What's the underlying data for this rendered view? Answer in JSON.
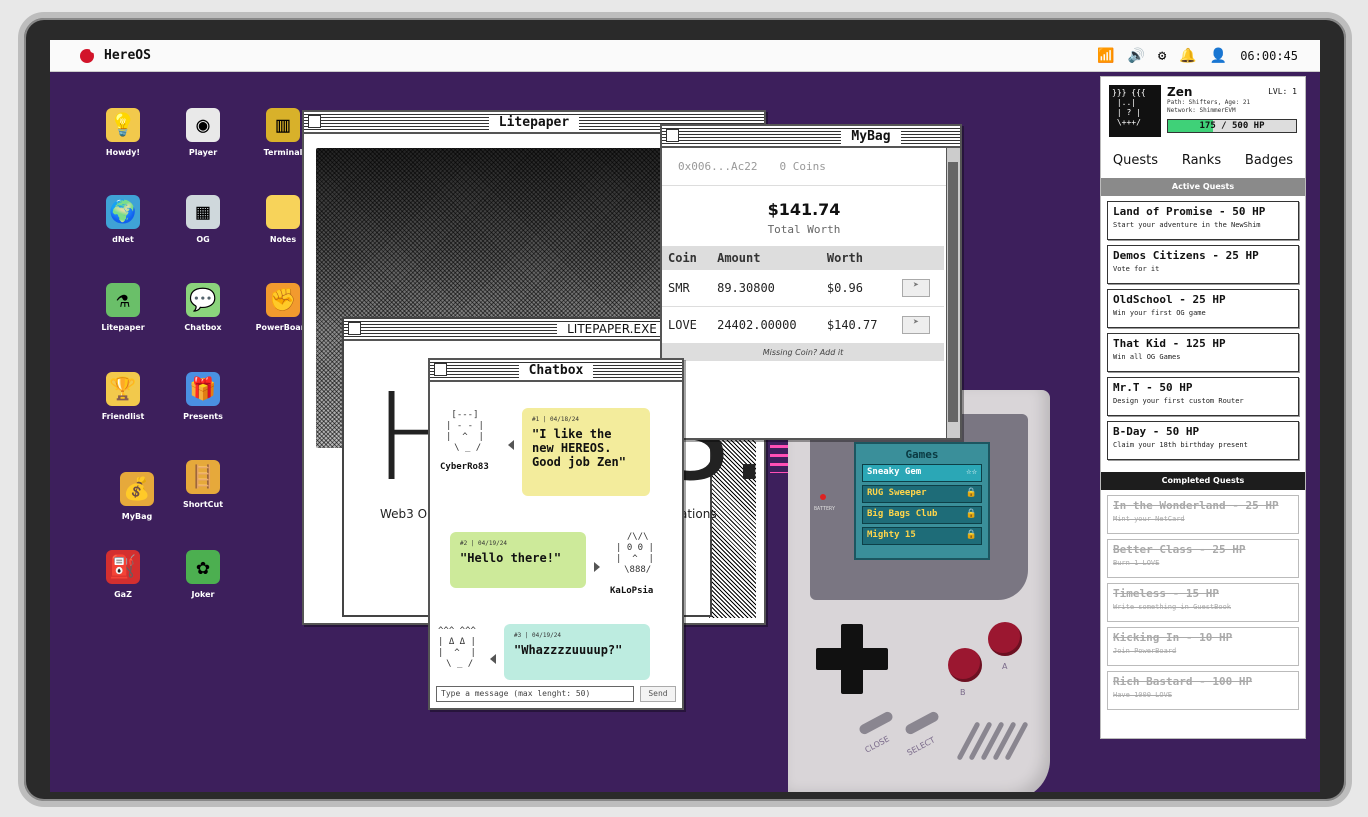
{
  "menubar": {
    "os_name": "HereOS",
    "clock": "06:00:45"
  },
  "desktop_icons": [
    {
      "label": "Howdy!",
      "glyph": "💡",
      "bg": "#f2c94c"
    },
    {
      "label": "Player",
      "glyph": "◉",
      "bg": "#e9e9e9"
    },
    {
      "label": "Terminal",
      "glyph": "▥",
      "bg": "#d8b12a"
    },
    {
      "label": "dNet",
      "glyph": "🌍",
      "bg": "#3fa2d6"
    },
    {
      "label": "OG",
      "glyph": "▦",
      "bg": "#cfd8dc"
    },
    {
      "label": "Notes",
      "glyph": "",
      "bg": "#f7d35a"
    },
    {
      "label": "Litepaper",
      "glyph": "⚗",
      "bg": "#6abf69"
    },
    {
      "label": "Chatbox",
      "glyph": "💬",
      "bg": "#8bd47c"
    },
    {
      "label": "PowerBoard",
      "glyph": "✊",
      "bg": "#f29a2e"
    },
    {
      "label": "Friendlist",
      "glyph": "🏆",
      "bg": "#f2c94c"
    },
    {
      "label": "Presents",
      "glyph": "🎁",
      "bg": "#4a90e2"
    },
    {
      "label": "MyBag",
      "glyph": "💰",
      "bg": "#e6a93b"
    },
    {
      "label": "ShortCut",
      "glyph": "🪜",
      "bg": "#e6a93b"
    },
    {
      "label": "GaZ",
      "glyph": "⛽",
      "bg": "#d32f2f"
    },
    {
      "label": "Joker",
      "glyph": "✿",
      "bg": "#4caf50"
    }
  ],
  "litepaper": {
    "title": "Litepaper",
    "inner_title": "LITEPAPER.EXE",
    "big_h": "H",
    "big_s": "S.",
    "tagline_left": "Web3 O",
    "tagline_right": "ations"
  },
  "mybag": {
    "title": "MyBag",
    "address": "0x006...Ac22",
    "coins": "0 Coins",
    "total": "$141.74",
    "total_caption": "Total Worth",
    "headers": [
      "Coin",
      "Amount",
      "Worth"
    ],
    "rows": [
      {
        "coin": "SMR",
        "amount": "89.30800",
        "worth": "$0.96"
      },
      {
        "coin": "LOVE",
        "amount": "24402.00000",
        "worth": "$140.77"
      }
    ],
    "missing": "Missing Coin? Add it"
  },
  "chatbox": {
    "title": "Chatbox",
    "messages": [
      {
        "avatar": "[---]\n| - - |\n|  ^  |\n \\ _ /",
        "name": "CyberRo83",
        "meta": "#1 | 04/18/24",
        "text": "\"I like the new HEREOS. Good job Zen\"",
        "color": "#f3ec9c"
      },
      {
        "avatar": " /\\/\\\n| 0 0 |\n|  ^  |\n \\888/",
        "name": "KaLoPsia",
        "meta": "#2 | 04/19/24",
        "text": "\"Hello there!\"",
        "color": "#cdea9a"
      },
      {
        "avatar": "^^^ ^^^\n| Δ Δ |\n|  ^  |\n \\ _ /",
        "name": "",
        "meta": "#3 | 04/19/24",
        "text": "\"Whazzzzuuuup?\"",
        "color": "#bdece0"
      }
    ],
    "input_placeholder": "Type a message (max lenght: 50)",
    "send": "Send"
  },
  "gameboy": {
    "menu_title": "Games",
    "items": [
      {
        "name": "Sneaky Gem",
        "badge": "☆☆"
      },
      {
        "name": "RUG Sweeper",
        "badge": "🔒"
      },
      {
        "name": "Big Bags Club",
        "badge": "🔒"
      },
      {
        "name": "Mighty 15",
        "badge": "🔒"
      }
    ],
    "battery": "BATTERY",
    "label_b": "B",
    "label_a": "A",
    "label_close": "CLOSE",
    "label_select": "SELECT"
  },
  "profile": {
    "name": "Zen",
    "level": "LVL: 1",
    "path": "Path: Shifters, Age: 21",
    "network": "Network: ShimmerEVM",
    "hp_text": "175 / 500 HP",
    "hp_fraction": 0.35,
    "art": "}}} {{{\n |..| \n | ? |\n \\+++/",
    "tabs": [
      "Quests",
      "Ranks",
      "Badges"
    ],
    "active_title": "Active Quests",
    "active_quests": [
      {
        "title": "Land of Promise - 50 HP",
        "desc": "Start your adventure in the NewShim"
      },
      {
        "title": "Demos Citizens - 25 HP",
        "desc": "Vote for it"
      },
      {
        "title": "OldSchool - 25 HP",
        "desc": "Win your first OG game"
      },
      {
        "title": "That Kid - 125 HP",
        "desc": "Win all OG Games"
      },
      {
        "title": "Mr.T - 50 HP",
        "desc": "Design your first custom Router"
      },
      {
        "title": "B-Day - 50 HP",
        "desc": "Claim your 18th birthday present"
      }
    ],
    "completed_title": "Completed Quests",
    "completed_quests": [
      {
        "title": "In the Wonderland - 25 HP",
        "desc": "Mint your NetCard"
      },
      {
        "title": "Better Class - 25 HP",
        "desc": "Burn 1 LOVE"
      },
      {
        "title": "Timeless - 15 HP",
        "desc": "Write something in GuestBook"
      },
      {
        "title": "Kicking In - 10 HP",
        "desc": "Join PowerBoard"
      },
      {
        "title": "Rich Bastard - 100 HP",
        "desc": "Have 1000 LOVE"
      }
    ]
  }
}
